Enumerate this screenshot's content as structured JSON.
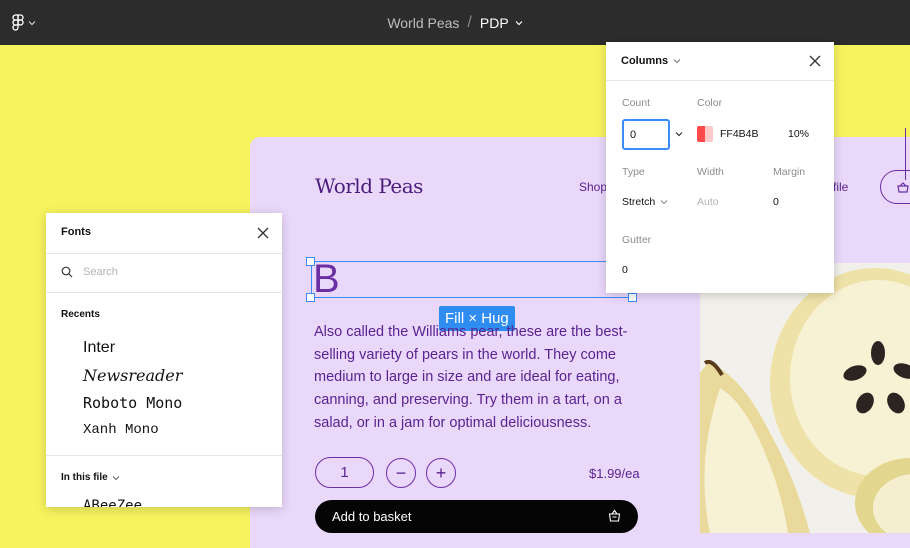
{
  "toolbar": {
    "file_name": "World Peas",
    "separator": "/",
    "page_name": "PDP"
  },
  "canvas": {
    "brand": "World Peas",
    "nav_shop": "Shop",
    "nav_profile_partial": "file",
    "heading_letter": "B",
    "fill_tag": "Fill × Hug",
    "description": "Also called the Williams pear, these are the best-selling variety of pears in the world. They come medium to large in size and are ideal for eating, canning, and preserving. Try them in a tart, on a salad, or in a jam for optimal deliciousness.",
    "quantity": "1",
    "minus": "−",
    "plus": "+",
    "price": "$1.99/ea",
    "add_to_basket": "Add to basket"
  },
  "fonts_panel": {
    "title": "Fonts",
    "search_placeholder": "Search",
    "recents_label": "Recents",
    "recents": [
      "Inter",
      "Newsreader",
      "Roboto Mono",
      "Xanh Mono"
    ],
    "in_this_file_label": "In this file",
    "in_this_file": [
      "ABeeZee"
    ]
  },
  "columns_panel": {
    "title": "Columns",
    "count_label": "Count",
    "count_value": "0",
    "color_label": "Color",
    "color_hex": "FF4B4B",
    "color_opacity": "10%",
    "type_label": "Type",
    "type_value": "Stretch",
    "width_label": "Width",
    "width_value": "Auto",
    "margin_label": "Margin",
    "margin_value": "0",
    "gutter_label": "Gutter",
    "gutter_value": "0"
  },
  "colors": {
    "canvas_bg": "#f6f35f",
    "toolbar_bg": "#2c2c2c",
    "frame_bg": "#ead8fb",
    "brand_purple": "#4b1c7c",
    "selection_blue": "#3b8cf7",
    "column_color": "#FF4B4B"
  }
}
